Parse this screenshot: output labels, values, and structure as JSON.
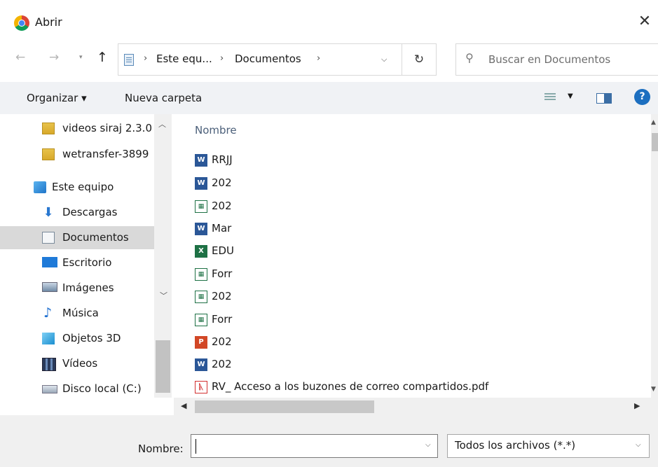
{
  "window": {
    "title": "Abrir",
    "close_glyph": "✕"
  },
  "nav": {
    "back_glyph": "←",
    "forward_glyph": "→",
    "recent_glyph": "▾",
    "up_glyph": "↑",
    "breadcrumb": [
      "Este equ...",
      "Documentos"
    ],
    "separator": "›",
    "dropdown_glyph": "⌵",
    "refresh_glyph": "↻"
  },
  "search": {
    "placeholder": "Buscar en Documentos",
    "icon": "search-icon"
  },
  "toolbar": {
    "organize_label": "Organizar ▾",
    "new_folder_label": "Nueva carpeta",
    "help_label": "?"
  },
  "sidebar": {
    "items": [
      {
        "label": "videos siraj 2.3.0",
        "icon": "zip-folder-icon"
      },
      {
        "label": "wetransfer-3899",
        "icon": "zip-folder-icon"
      },
      {
        "label": "Este equipo",
        "icon": "computer-icon"
      },
      {
        "label": "Descargas",
        "icon": "download-icon"
      },
      {
        "label": "Documentos",
        "icon": "documents-icon",
        "selected": true
      },
      {
        "label": "Escritorio",
        "icon": "desktop-icon"
      },
      {
        "label": "Imágenes",
        "icon": "pictures-icon"
      },
      {
        "label": "Música",
        "icon": "music-icon"
      },
      {
        "label": "Objetos 3D",
        "icon": "objects3d-icon"
      },
      {
        "label": "Vídeos",
        "icon": "videos-icon"
      },
      {
        "label": "Disco local (C:)",
        "icon": "drive-icon"
      }
    ]
  },
  "files": {
    "column_header": "Nombre",
    "items": [
      {
        "name": "RRJJ",
        "type": "word"
      },
      {
        "name": "202",
        "type": "word"
      },
      {
        "name": "202",
        "type": "sheet"
      },
      {
        "name": "Mar",
        "type": "word"
      },
      {
        "name": "EDU",
        "type": "excel"
      },
      {
        "name": "Forr",
        "type": "sheet"
      },
      {
        "name": "202",
        "type": "sheet"
      },
      {
        "name": "Forr",
        "type": "sheet"
      },
      {
        "name": "202",
        "type": "powerpoint"
      },
      {
        "name": "202",
        "type": "word"
      },
      {
        "name": "RV_ Acceso a los buzones de correo compartidos.pdf",
        "type": "pdf"
      }
    ]
  },
  "bottom": {
    "name_label": "Nombre:",
    "name_value": "",
    "filter_value": "Todos los archivos (*.*)",
    "dropdown_glyph": "⌵"
  },
  "colors": {
    "accent": "#1c6fc0",
    "selected_bg": "#d9d9d9",
    "toolbar_bg": "#f0f2f5"
  }
}
